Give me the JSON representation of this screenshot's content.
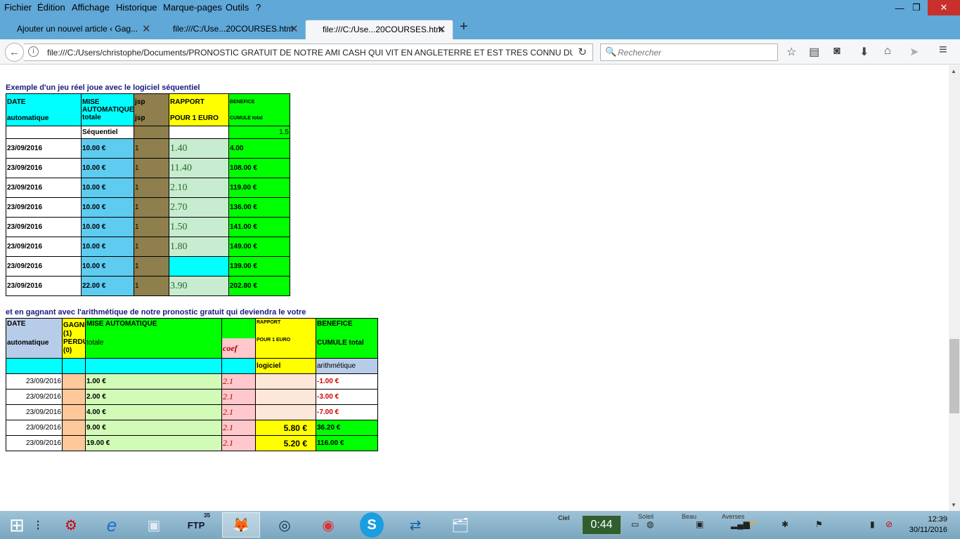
{
  "menubar": {
    "items": [
      "Fichier",
      "Édition",
      "Affichage",
      "Historique",
      "Marque-pages",
      "Outils",
      "?"
    ],
    "window_controls": [
      "—",
      "❐",
      "✕"
    ]
  },
  "tabs": [
    {
      "label": "Ajouter un nouvel article ‹ Gag...",
      "close": "✕"
    },
    {
      "label": "file:///C:/Use...20COURSES.htm",
      "close": "✕"
    },
    {
      "label": "file:///C:/Use...20COURSES.htm",
      "close": "✕",
      "active": true
    }
  ],
  "newtab_label": "+",
  "nav": {
    "back_icon": "←",
    "info_icon": "i",
    "url": "file:///C:/Users/christophe/Documents/PRONOSTIC GRATUIT DE NOTRE AMI CASH QUI VIT EN ANGLETERRE ET EST TRES CONNU DU M",
    "reload_icon": "↻",
    "search_icon": "🔍",
    "search_placeholder": "Rechercher",
    "toolbar_icons": [
      "☆",
      "▤",
      "◙",
      "⬇",
      "⌂",
      "➤",
      "≡"
    ]
  },
  "section1": {
    "caption": "Exemple d'un jeu réel joue avec le logiciel séquentiel",
    "header": {
      "date_a": "DATE",
      "date_b": "automatique",
      "mise_a": "MISE",
      "mise_b": "AUTOMATIQUE",
      "mise_c": "totale",
      "jsp_a": "jsp",
      "jsp_b": "jsp",
      "rapport_a": "RAPPORT",
      "rapport_b": "POUR 1 EURO",
      "benef_a": "BENEFICE",
      "benef_b": "CUMULE total"
    },
    "subheader": {
      "mise": "Séquentiel",
      "benef": "1.5"
    },
    "rows": [
      {
        "date": "23/09/2016",
        "mise": "10.00 €",
        "jsp": "1",
        "rapport": "1.40",
        "benef": "4.00"
      },
      {
        "date": "23/09/2016",
        "mise": "10.00 €",
        "jsp": "1",
        "rapport": "11.40",
        "benef": "108.00 €"
      },
      {
        "date": "23/09/2016",
        "mise": "10.00 €",
        "jsp": "1",
        "rapport": "2.10",
        "benef": "119.00 €"
      },
      {
        "date": "23/09/2016",
        "mise": "10.00 €",
        "jsp": "1",
        "rapport": "2.70",
        "benef": "136.00 €"
      },
      {
        "date": "23/09/2016",
        "mise": "10.00 €",
        "jsp": "1",
        "rapport": "1.50",
        "benef": "141.00 €"
      },
      {
        "date": "23/09/2016",
        "mise": "10.00 €",
        "jsp": "1",
        "rapport": "1.80",
        "benef": "149.00 €"
      },
      {
        "date": "23/09/2016",
        "mise": "10.00 €",
        "jsp": "1",
        "rapport": "",
        "benef": "139.00 €"
      },
      {
        "date": "23/09/2016",
        "mise": "22.00 €",
        "jsp": "1",
        "rapport": "3.90",
        "benef": "202.80 €"
      }
    ]
  },
  "section2": {
    "caption": "et en gagnant avec l'arithmétique de notre  pronostic gratuit qui deviendra le votre",
    "header": {
      "date_a": "DATE",
      "date_b": "automatique",
      "gagne": "GAGNE (1) PERDU (0)",
      "mise_a": "MISE AUTOMATIQUE",
      "mise_b": "totale",
      "coef": "coef",
      "rapport_a": "RAPPORT",
      "rapport_b": "POUR 1 EURO",
      "benef_a": "BENEFICE",
      "benef_b": "CUMULE total"
    },
    "subheader": {
      "rapport": "logiciel",
      "benef": "arithmétique"
    },
    "rows": [
      {
        "date": "23/09/2016",
        "mise": "1.00 €",
        "coef": "2.1",
        "rapport": "",
        "benef": "-1.00 €"
      },
      {
        "date": "23/09/2016",
        "mise": "2.00 €",
        "coef": "2.1",
        "rapport": "",
        "benef": "-3.00 €"
      },
      {
        "date": "23/09/2016",
        "mise": "4.00 €",
        "coef": "2.1",
        "rapport": "",
        "benef": "-7.00 €"
      },
      {
        "date": "23/09/2016",
        "mise": "9.00 €",
        "coef": "2.1",
        "rapport": "5.80 €",
        "benef": "36.20 €"
      },
      {
        "date": "23/09/2016",
        "mise": "19.00 €",
        "coef": "2.1",
        "rapport": "5.20 €",
        "benef": "116.00 €"
      }
    ]
  },
  "taskbar": {
    "apps": [
      "⊞",
      "⁝",
      "⚙",
      "e",
      "▣",
      "FTP",
      "🦊",
      "◎",
      "◉",
      "S",
      "⇄",
      "🗂"
    ],
    "ftp_badge": "35",
    "ciel_label": "Ciel",
    "timer": "0:44",
    "weather": [
      "Soleil",
      "Beau",
      "Averses"
    ],
    "battery": "54",
    "time": "12:39",
    "date": "30/11/2016"
  }
}
